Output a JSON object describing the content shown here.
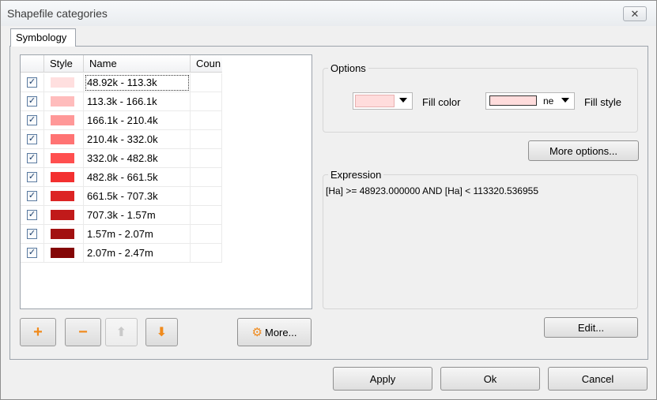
{
  "window": {
    "title": "Shapefile categories",
    "close_glyph": "✕"
  },
  "tabs": [
    {
      "label": "Symbology"
    }
  ],
  "grid": {
    "headers": {
      "style": "Style",
      "name": "Name",
      "count": "Coun"
    },
    "rows": [
      {
        "checked": true,
        "color": "#ffdfdf",
        "label": "48.92k - 113.3k"
      },
      {
        "checked": true,
        "color": "#ffbcbc",
        "label": "113.3k - 166.1k"
      },
      {
        "checked": true,
        "color": "#ff9898",
        "label": "166.1k - 210.4k"
      },
      {
        "checked": true,
        "color": "#ff7373",
        "label": "210.4k - 332.0k"
      },
      {
        "checked": true,
        "color": "#ff4f4f",
        "label": "332.0k - 482.8k"
      },
      {
        "checked": true,
        "color": "#f33030",
        "label": "482.8k - 661.5k"
      },
      {
        "checked": true,
        "color": "#dc2424",
        "label": "661.5k - 707.3k"
      },
      {
        "checked": true,
        "color": "#c11a1a",
        "label": "707.3k - 1.57m"
      },
      {
        "checked": true,
        "color": "#a21010",
        "label": "1.57m - 2.07m"
      },
      {
        "checked": true,
        "color": "#840606",
        "label": "2.07m - 2.47m"
      }
    ]
  },
  "toolbar": {
    "add_glyph": "+",
    "remove_glyph": "−",
    "up_glyph": "⬆",
    "down_glyph": "⬇",
    "more_label": "More...",
    "more_icon_glyph": "⚙"
  },
  "options": {
    "legend": "Options",
    "fill_color_label": "Fill color",
    "fill_color_value": "#ffdcdc",
    "fill_style_label": "Fill style",
    "fill_style_value": "ne",
    "fill_style_swatch": "#ffdcdc",
    "more_options_label": "More options..."
  },
  "expression": {
    "legend": "Expression",
    "text": "[Ha] >= 48923.000000 AND [Ha] < 113320.536955"
  },
  "buttons": {
    "edit": "Edit...",
    "apply": "Apply",
    "ok": "Ok",
    "cancel": "Cancel"
  },
  "colors": {
    "accent_orange": "#f08a1c",
    "checkbox_check": "#1c3e6b"
  }
}
